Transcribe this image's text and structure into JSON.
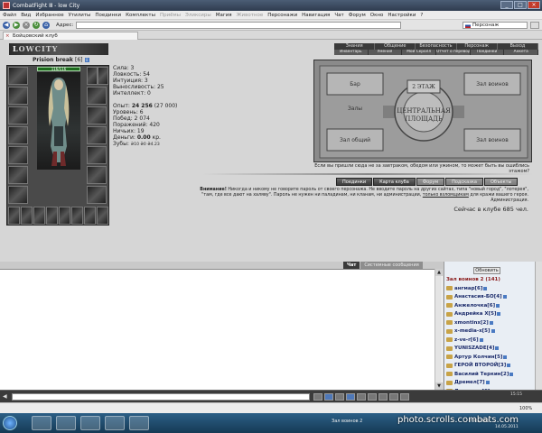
{
  "window": {
    "title": "CombatFight Ⅲ - low City"
  },
  "menu": [
    {
      "label": "Файл",
      "disabled": false
    },
    {
      "label": "Вид",
      "disabled": false
    },
    {
      "label": "Избранное",
      "disabled": false
    },
    {
      "label": "Утилиты",
      "disabled": false
    },
    {
      "label": "Поединки",
      "disabled": false
    },
    {
      "label": "Комплекты",
      "disabled": false
    },
    {
      "label": "Приёмы",
      "disabled": true
    },
    {
      "label": "Эликсиры",
      "disabled": true
    },
    {
      "label": "Магия",
      "disabled": false
    },
    {
      "label": "Животное",
      "disabled": true
    },
    {
      "label": "Персонажи",
      "disabled": false
    },
    {
      "label": "Навигация",
      "disabled": false
    },
    {
      "label": "Чат",
      "disabled": false
    },
    {
      "label": "Форум",
      "disabled": false
    },
    {
      "label": "Окно",
      "disabled": false
    },
    {
      "label": "Настройки",
      "disabled": false
    },
    {
      "label": "?",
      "disabled": false
    }
  ],
  "toolbar": {
    "address_label": "Адрес:",
    "search_value": "Персонаж"
  },
  "browser_tab": {
    "label": "Бойцовский клуб"
  },
  "site": {
    "logo_prefix": "L",
    "logo_rest": "OWCITY",
    "top_nav": [
      "Знания",
      "Общение",
      "Безопасность",
      "Персонаж",
      "Выход"
    ],
    "sub_nav": [
      "Инвентарь",
      "Умения",
      "Мой Скролл",
      "Отчет о переводах",
      "Поединки",
      "Анкета"
    ]
  },
  "character": {
    "name": "Prision break",
    "level": "[6]",
    "hp": "116/116",
    "stats": {
      "strength": "Сила: 3",
      "agility": "Ловкость: 54",
      "intuition": "Интуиция: 3",
      "endurance": "Выносливость: 25",
      "intellect": "Интеллект: 0"
    },
    "experience_label": "Опыт:",
    "experience_value": "24 256",
    "experience_next": "(27 000)",
    "level_line": "Уровень: 6",
    "wins": "Побед: 2 074",
    "losses": "Поражений: 420",
    "draws": "Ничьих: 19",
    "money_label": "Деньги:",
    "money_value": "0.00",
    "money_unit": "кр.",
    "teeth_label": "Зубы:",
    "teeth_value": "₴10 ₴0 ₴4.23"
  },
  "map": {
    "labels": {
      "top_left": "Бар",
      "top_right": "Зал воинов",
      "mid_left": "Залы",
      "center_top": "2 ЭТАЖ",
      "center": "ЦЕНТРАЛЬНАЯ ПЛОЩАДЬ",
      "bottom_left": "Зал общий",
      "bottom_right": "Зал воинов"
    },
    "caption": "Если вы пришли сюда не за завтраком, обедом или ужином, то может быть вы ошиблись этажом?"
  },
  "actions": [
    "Поединки",
    "Карта клуба",
    "Форум",
    "Подсказка",
    "Объекты"
  ],
  "actions_dim": [
    false,
    false,
    true,
    true,
    true
  ],
  "warning": {
    "bold_prefix": "Внимание!",
    "text1": " Никогда и никому не говорите пароль от своего персонажа. Не вводите пароль на других сайтах, типа \"новый город\", \"лотерея\",",
    "text2": "\"там, где все дают на халяву\". Пароль не нужен ни паладинам, ни кланам, ни администрации,",
    "link": "только взломщикам",
    "text3": " для кражи вашего героя.",
    "signature": "Администрация."
  },
  "online": "Сейчас в клубе 685 чел.",
  "chat": {
    "tabs": [
      {
        "label": "Чат",
        "active": true
      },
      {
        "label": "Системные сообщения",
        "active": false
      }
    ]
  },
  "players_panel": {
    "refresh_label": "Обновить",
    "heading": "Зал воинов 2 (141)",
    "players": [
      "ангмар[6]",
      "Анастасия-БО[4]",
      "Анжелочка[6]",
      "Андрейка X[5]",
      "xmontinx[2]",
      "x-media-x[5]",
      "z-ve-r[6]",
      "YUNISZADE[4]",
      "Артур Колчин[5]",
      "ГЕРОЙ ВТОРОЙ[3]",
      "Василий Теркин[2]",
      "Дремел[7]",
      "Дезертир[6]"
    ]
  },
  "chat_input": {
    "time": "15:15"
  },
  "status_bar": {
    "zoom": "100%"
  },
  "taskbar": {
    "app_label": "CombatFight Ⅲ",
    "hall_label": "Зал воинов 2",
    "tray_text": "HI0 / MO",
    "date": "14.05.2011"
  },
  "watermark": "photo.scrolls.combats.com"
}
